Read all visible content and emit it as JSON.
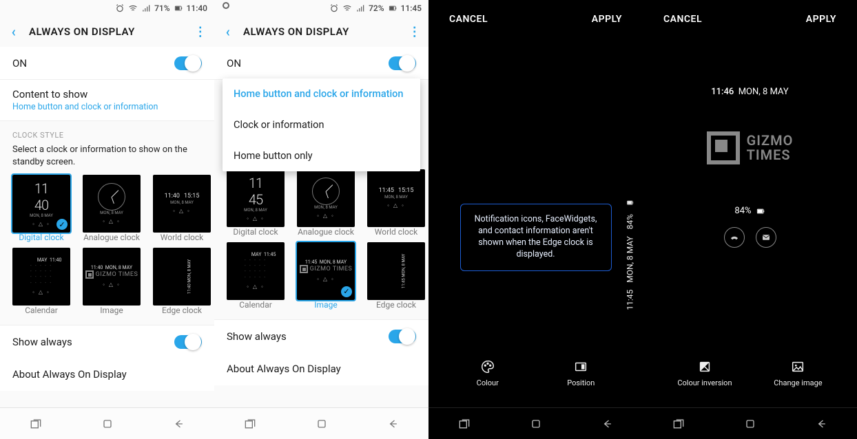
{
  "panel1": {
    "status": {
      "battery": "71%",
      "time": "11:40"
    },
    "header_title": "ALWAYS ON DISPLAY",
    "on_label": "ON",
    "content_to_show": "Content to show",
    "content_sub": "Home button and clock or information",
    "clock_style": "CLOCK STYLE",
    "hint": "Select a clock or information to show on the standby screen.",
    "thumbs": {
      "digital": "Digital clock",
      "analogue": "Analogue clock",
      "world": "World clock",
      "calendar": "Calendar",
      "image": "Image",
      "edge": "Edge clock"
    },
    "thumb_time": "11\n40",
    "world_times": [
      "11:40",
      "15:15"
    ],
    "date_small": "MON, 8 MAY",
    "brand_small": "GIZMO TIMES",
    "show_always": "Show always",
    "about": "About Always On Display"
  },
  "panel2": {
    "status": {
      "battery": "72%",
      "time": "11:45"
    },
    "header_title": "ALWAYS ON DISPLAY",
    "on_label": "ON",
    "menu": {
      "opt1": "Home button and clock or information",
      "opt2": "Clock or information",
      "opt3": "Home button only"
    },
    "thumbs": {
      "digital": "Digital clock",
      "analogue": "Analogue clock",
      "world": "World clock",
      "calendar": "Calendar",
      "image": "Image",
      "edge": "Edge clock"
    },
    "world_times": [
      "11:45",
      "15:15"
    ],
    "date_small": "MON, 8 MAY",
    "show_always": "Show always",
    "about": "About Always On Display"
  },
  "panel3": {
    "cancel": "CANCEL",
    "apply": "APPLY",
    "notice": "Notification icons, FaceWidgets, and contact information aren't shown when the Edge clock is displayed.",
    "side_time": "11:45",
    "side_date": "MON, 8 MAY",
    "side_batt": "84%",
    "colour": "Colour",
    "position": "Position"
  },
  "panel4": {
    "cancel": "CANCEL",
    "apply": "APPLY",
    "time": "11:46",
    "date": "MON, 8 MAY",
    "brand_top": "GIZMO",
    "brand_bot": "TIMES",
    "batt": "84%",
    "inversion": "Colour inversion",
    "change": "Change image"
  }
}
